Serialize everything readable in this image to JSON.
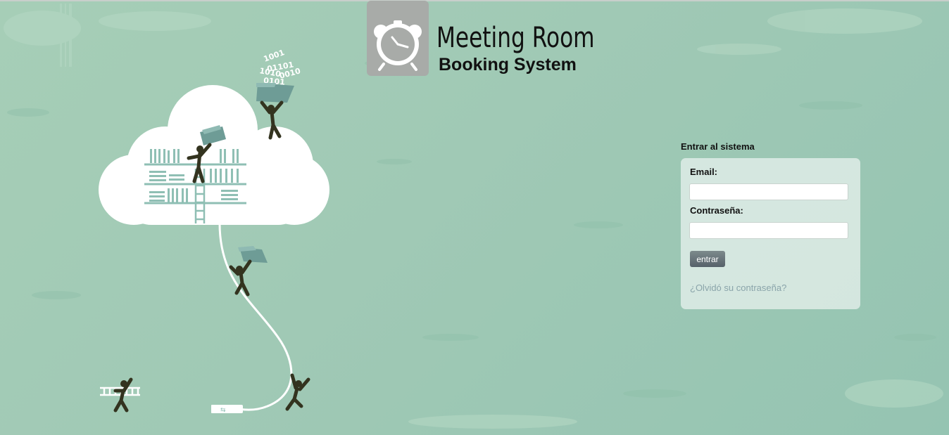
{
  "logo": {
    "title": "Meeting Room",
    "subtitle": "Booking System",
    "icon": "alarm-clock-icon"
  },
  "illustration": {
    "binary_digits": [
      "1001",
      "01101",
      "1010",
      "0010",
      "0101"
    ]
  },
  "login": {
    "heading": "Entrar al sistema",
    "email_label": "Email:",
    "email_value": "",
    "password_label": "Contraseña:",
    "password_value": "",
    "submit_label": "entrar",
    "forgot_link": "¿Olvidó su contraseña?"
  },
  "colors": {
    "background": "#a3cbb6",
    "panel": "#e3eeea",
    "button": "#5f6b72",
    "link": "#8aa4aa"
  }
}
